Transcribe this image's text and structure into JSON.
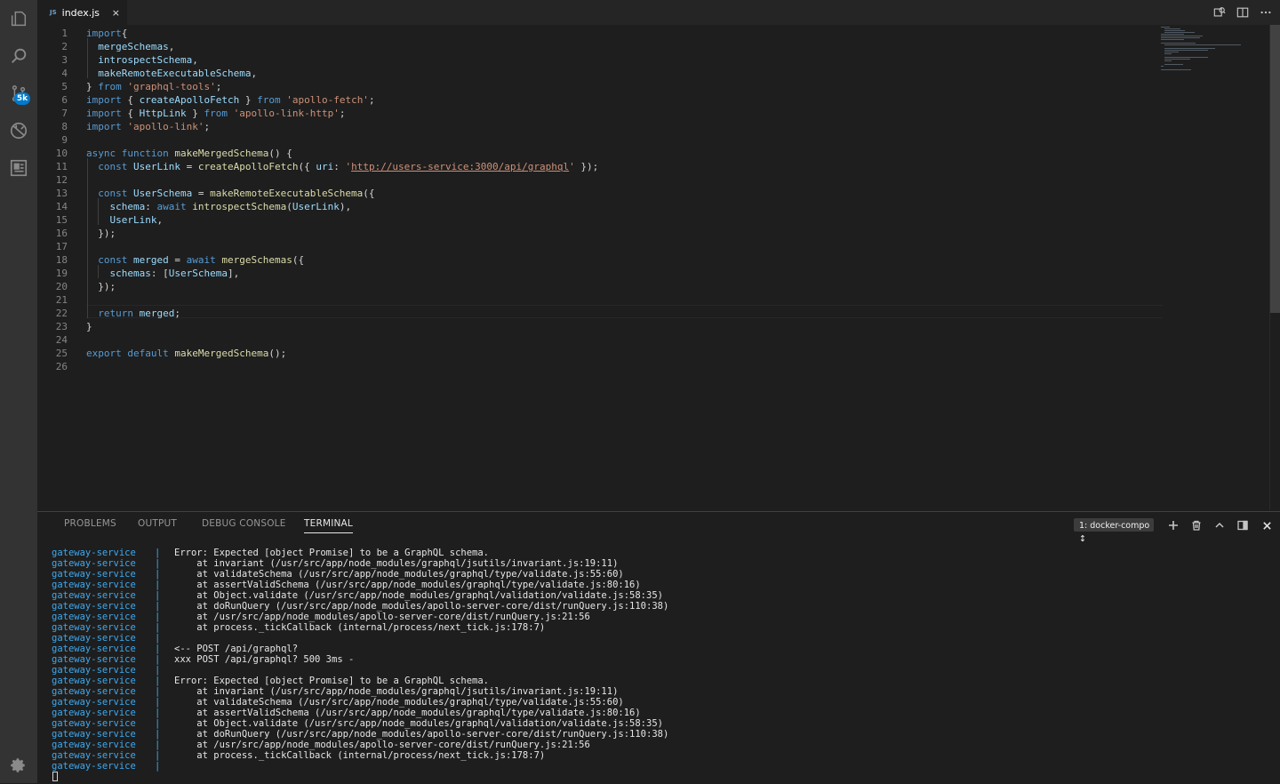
{
  "activity_bar": {
    "source_control_badge": "5k"
  },
  "tab": {
    "lang": "JS",
    "title": "index.js",
    "close": "×"
  },
  "editor_lines": [
    {
      "n": "1",
      "code": [
        [
          "kw",
          "import"
        ],
        [
          "",
          "{"
        ]
      ]
    },
    {
      "n": "2",
      "code": [
        [
          "",
          "  "
        ],
        [
          "var",
          "mergeSchemas"
        ],
        [
          "",
          ","
        ]
      ]
    },
    {
      "n": "3",
      "code": [
        [
          "",
          "  "
        ],
        [
          "var",
          "introspectSchema"
        ],
        [
          "",
          ","
        ]
      ]
    },
    {
      "n": "4",
      "code": [
        [
          "",
          "  "
        ],
        [
          "var",
          "makeRemoteExecutableSchema"
        ],
        [
          "",
          ","
        ]
      ]
    },
    {
      "n": "5",
      "code": [
        [
          "",
          "} "
        ],
        [
          "kw",
          "from"
        ],
        [
          "",
          " "
        ],
        [
          "str",
          "'graphql-tools'"
        ],
        [
          "",
          ";"
        ]
      ]
    },
    {
      "n": "6",
      "code": [
        [
          "kw",
          "import"
        ],
        [
          "",
          " { "
        ],
        [
          "var",
          "createApolloFetch"
        ],
        [
          "",
          " } "
        ],
        [
          "kw",
          "from"
        ],
        [
          "",
          " "
        ],
        [
          "str",
          "'apollo-fetch'"
        ],
        [
          "",
          ";"
        ]
      ]
    },
    {
      "n": "7",
      "code": [
        [
          "kw",
          "import"
        ],
        [
          "",
          " { "
        ],
        [
          "var",
          "HttpLink"
        ],
        [
          "",
          " } "
        ],
        [
          "kw",
          "from"
        ],
        [
          "",
          " "
        ],
        [
          "str",
          "'apollo-link-http'"
        ],
        [
          "",
          ";"
        ]
      ]
    },
    {
      "n": "8",
      "code": [
        [
          "kw",
          "import"
        ],
        [
          "",
          " "
        ],
        [
          "str",
          "'apollo-link'"
        ],
        [
          "",
          ";"
        ]
      ]
    },
    {
      "n": "9",
      "code": []
    },
    {
      "n": "10",
      "code": [
        [
          "kw",
          "async"
        ],
        [
          "",
          " "
        ],
        [
          "kw",
          "function"
        ],
        [
          "",
          " "
        ],
        [
          "fn",
          "makeMergedSchema"
        ],
        [
          "",
          "() {"
        ]
      ]
    },
    {
      "n": "11",
      "code": [
        [
          "",
          "  "
        ],
        [
          "kw",
          "const"
        ],
        [
          "",
          " "
        ],
        [
          "var",
          "UserLink"
        ],
        [
          "",
          " = "
        ],
        [
          "fn",
          "createApolloFetch"
        ],
        [
          "",
          "({ "
        ],
        [
          "var",
          "uri"
        ],
        [
          "",
          ": "
        ],
        [
          "str",
          "'"
        ],
        [
          "str link",
          "http://users-service:3000/api/graphql"
        ],
        [
          "str",
          "'"
        ],
        [
          "",
          " });"
        ]
      ]
    },
    {
      "n": "12",
      "code": []
    },
    {
      "n": "13",
      "code": [
        [
          "",
          "  "
        ],
        [
          "kw",
          "const"
        ],
        [
          "",
          " "
        ],
        [
          "var",
          "UserSchema"
        ],
        [
          "",
          " = "
        ],
        [
          "fn",
          "makeRemoteExecutableSchema"
        ],
        [
          "",
          "({"
        ]
      ]
    },
    {
      "n": "14",
      "code": [
        [
          "",
          "    "
        ],
        [
          "var",
          "schema"
        ],
        [
          "",
          ": "
        ],
        [
          "kw",
          "await"
        ],
        [
          "",
          " "
        ],
        [
          "fn",
          "introspectSchema"
        ],
        [
          "",
          "("
        ],
        [
          "var",
          "UserLink"
        ],
        [
          "",
          "),"
        ]
      ]
    },
    {
      "n": "15",
      "code": [
        [
          "",
          "    "
        ],
        [
          "var",
          "UserLink"
        ],
        [
          "",
          ","
        ]
      ]
    },
    {
      "n": "16",
      "code": [
        [
          "",
          "  });"
        ]
      ]
    },
    {
      "n": "17",
      "code": []
    },
    {
      "n": "18",
      "code": [
        [
          "",
          "  "
        ],
        [
          "kw",
          "const"
        ],
        [
          "",
          " "
        ],
        [
          "var",
          "merged"
        ],
        [
          "",
          " = "
        ],
        [
          "kw",
          "await"
        ],
        [
          "",
          " "
        ],
        [
          "fn",
          "mergeSchemas"
        ],
        [
          "",
          "({"
        ]
      ]
    },
    {
      "n": "19",
      "code": [
        [
          "",
          "    "
        ],
        [
          "var",
          "schemas"
        ],
        [
          "",
          ": ["
        ],
        [
          "var",
          "UserSchema"
        ],
        [
          "",
          "],"
        ]
      ]
    },
    {
      "n": "20",
      "code": [
        [
          "",
          "  });"
        ]
      ]
    },
    {
      "n": "21",
      "code": []
    },
    {
      "n": "22",
      "code": [
        [
          "",
          "  "
        ],
        [
          "kw",
          "return"
        ],
        [
          "",
          " "
        ],
        [
          "var",
          "merged"
        ],
        [
          "",
          ";"
        ]
      ]
    },
    {
      "n": "23",
      "code": [
        [
          "",
          "}"
        ]
      ]
    },
    {
      "n": "24",
      "code": []
    },
    {
      "n": "25",
      "code": [
        [
          "kw",
          "export"
        ],
        [
          "",
          " "
        ],
        [
          "kw",
          "default"
        ],
        [
          "",
          " "
        ],
        [
          "fn",
          "makeMergedSchema"
        ],
        [
          "",
          "();"
        ]
      ]
    },
    {
      "n": "26",
      "code": []
    }
  ],
  "panel": {
    "tabs": [
      "PROBLEMS",
      "OUTPUT",
      "DEBUG CONSOLE",
      "TERMINAL"
    ],
    "terminal_select": "1: docker-compo ↕"
  },
  "terminal": {
    "service": "gateway-service",
    "pipe": "|",
    "lines": [
      "Error: Expected [object Promise] to be a GraphQL schema.",
      "    at invariant (/usr/src/app/node_modules/graphql/jsutils/invariant.js:19:11)",
      "    at validateSchema (/usr/src/app/node_modules/graphql/type/validate.js:55:60)",
      "    at assertValidSchema (/usr/src/app/node_modules/graphql/type/validate.js:80:16)",
      "    at Object.validate (/usr/src/app/node_modules/graphql/validation/validate.js:58:35)",
      "    at doRunQuery (/usr/src/app/node_modules/apollo-server-core/dist/runQuery.js:110:38)",
      "    at /usr/src/app/node_modules/apollo-server-core/dist/runQuery.js:21:56",
      "    at process._tickCallback (internal/process/next_tick.js:178:7)",
      "",
      "<-- POST /api/graphql?",
      "xxx POST /api/graphql? 500 3ms -",
      "",
      "Error: Expected [object Promise] to be a GraphQL schema.",
      "    at invariant (/usr/src/app/node_modules/graphql/jsutils/invariant.js:19:11)",
      "    at validateSchema (/usr/src/app/node_modules/graphql/type/validate.js:55:60)",
      "    at assertValidSchema (/usr/src/app/node_modules/graphql/type/validate.js:80:16)",
      "    at Object.validate (/usr/src/app/node_modules/graphql/validation/validate.js:58:35)",
      "    at doRunQuery (/usr/src/app/node_modules/apollo-server-core/dist/runQuery.js:110:38)",
      "    at /usr/src/app/node_modules/apollo-server-core/dist/runQuery.js:21:56",
      "    at process._tickCallback (internal/process/next_tick.js:178:7)",
      ""
    ]
  },
  "colors": {
    "accent": "#007acc",
    "service_label": "#3ea9ed"
  }
}
